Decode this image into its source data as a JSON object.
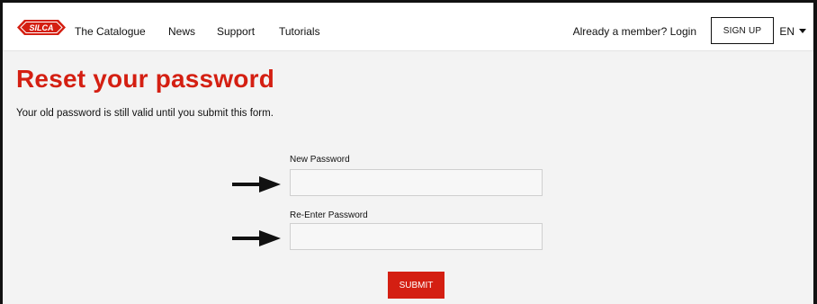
{
  "brand": {
    "logo_text": "SILCA",
    "color": "#d41f12"
  },
  "nav": {
    "items": [
      {
        "label": "The Catalogue"
      },
      {
        "label": "News"
      },
      {
        "label": "Support"
      },
      {
        "label": "Tutorials"
      }
    ],
    "login_label": "Already a member? Login",
    "signup_label": "SIGN UP",
    "language": "EN"
  },
  "page": {
    "title": "Reset your password",
    "subtitle": "Your old password is still valid until you submit this form."
  },
  "form": {
    "new_password_label": "New Password",
    "new_password_value": "",
    "reenter_password_label": "Re-Enter Password",
    "reenter_password_value": "",
    "submit_label": "SUBMIT"
  },
  "icons": {
    "arrow": "arrow-right-icon",
    "caret": "caret-down-icon"
  }
}
